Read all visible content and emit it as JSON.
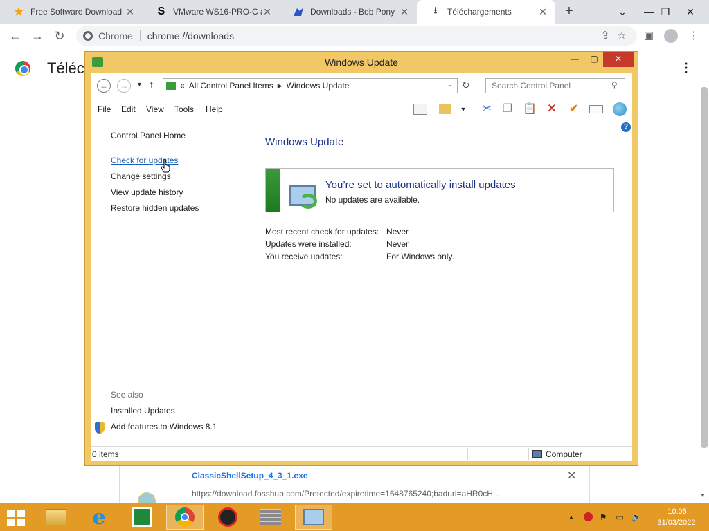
{
  "browser": {
    "tabs": [
      {
        "title": "Free Software Download",
        "icon": "star-icon"
      },
      {
        "title": "VMware WS16-PRO-C af",
        "icon": "s-letter-icon"
      },
      {
        "title": "Downloads - Bob Pony",
        "icon": "bob-pony-icon"
      },
      {
        "title": "Téléchargements",
        "icon": "download-icon"
      }
    ],
    "active_tab_index": 3,
    "omnibox": {
      "site_chip": "Chrome",
      "url": "chrome://downloads"
    }
  },
  "page": {
    "heading": "Téléc",
    "download": {
      "file_name": "ClassicShellSetup_4_3_1.exe",
      "url": "https://download.fosshub.com/Protected/expiretime=1648765240;badurl=aHR0cH..."
    }
  },
  "window": {
    "title": "Windows Update",
    "breadcrumb": [
      "All Control Panel Items",
      "Windows Update"
    ],
    "breadcrumb_prefix": "«",
    "search_placeholder": "Search Control Panel",
    "menu": [
      "File",
      "Edit",
      "View",
      "Tools",
      "Help"
    ],
    "sidebar": {
      "home": "Control Panel Home",
      "links": [
        "Check for updates",
        "Change settings",
        "View update history",
        "Restore hidden updates"
      ],
      "see_also": "See also",
      "see_also_links": [
        "Installed Updates",
        "Add features to Windows 8.1"
      ]
    },
    "main": {
      "heading": "Windows Update",
      "status_title": "You’re set to automatically install updates",
      "status_subtitle": "No updates are available.",
      "info": [
        {
          "label": "Most recent check for updates:",
          "value": "Never"
        },
        {
          "label": "Updates were installed:",
          "value": "Never"
        },
        {
          "label": "You receive updates:",
          "value": "For Windows only."
        }
      ]
    },
    "statusbar": {
      "items": "0 items",
      "location": "Computer"
    }
  },
  "taskbar": {
    "clock_time": "10:05",
    "clock_date": "31/03/2022"
  },
  "colors": {
    "window_frame": "#f2c867",
    "taskbar": "#e39b25",
    "link_blue": "#1a5fb4",
    "heading_blue": "#1e3287",
    "status_green": "#3a9a3a"
  }
}
